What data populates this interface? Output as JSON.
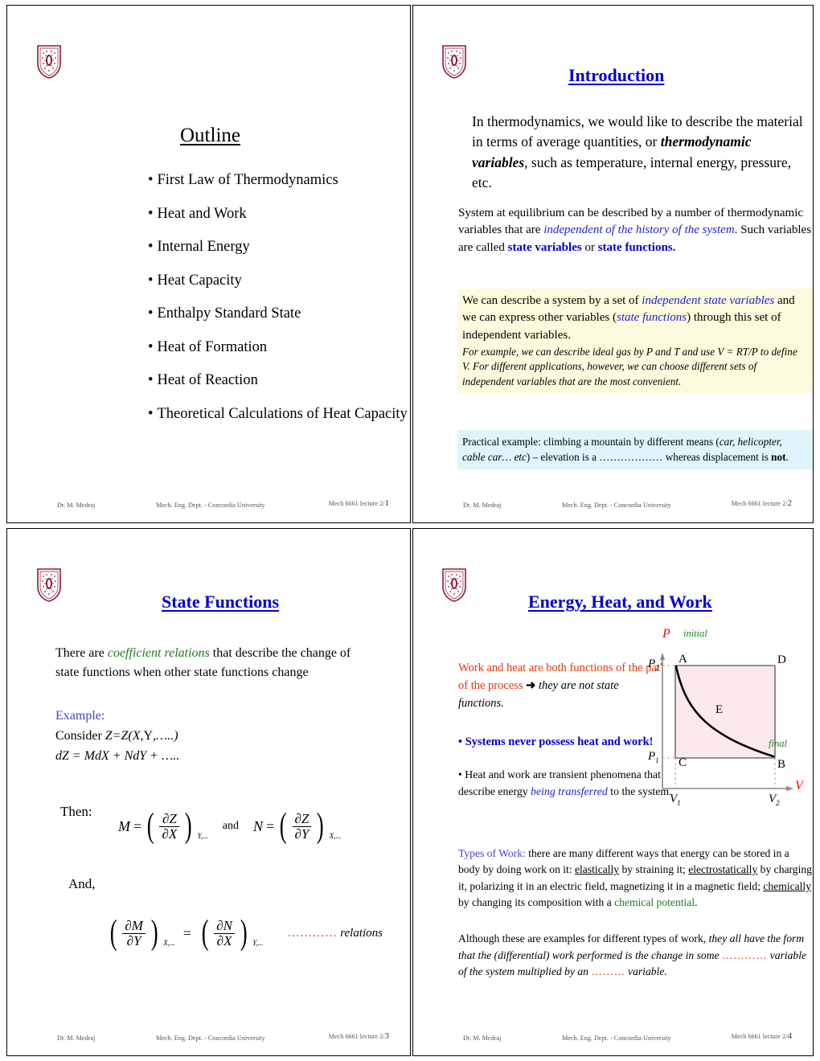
{
  "meta": {
    "author": "Dr. M. Medraj",
    "dept": "Mech. Eng. Dept. - Concordia University",
    "course_ref": "Mech 6661 lecture 2/",
    "logo_name": "Concordia University crest"
  },
  "slide1": {
    "title": "Outline",
    "bullet": "•",
    "items": [
      "First Law of Thermodynamics",
      "Heat and Work",
      "Internal Energy",
      "Heat Capacity",
      "Enthalpy Standard State",
      "Heat of Formation",
      "Heat of Reaction",
      "Theoretical Calculations of Heat Capacity"
    ],
    "page": "1"
  },
  "slide2": {
    "title": "Introduction",
    "p1_a": "In thermodynamics, we would like to describe the material in terms of average quantities, or ",
    "p1_em": "thermodynamic variables",
    "p1_b": ", such as temperature, internal energy, pressure, etc.",
    "p2_a": "System at equilibrium can be described by a number of thermodynamic variables that are ",
    "p2_em": "independent of the history of the system",
    "p2_b": ". Such variables are called ",
    "p2_s1": "state variables",
    "p2_c": " or ",
    "p2_s2": "state functions.",
    "p3_a": "We can describe a system by a set of ",
    "p3_em1": "independent state variables",
    "p3_b": " and we can express other variables (",
    "p3_em2": "state functions",
    "p3_c": ") through this set of independent variables.",
    "p3_it": "For example, we can describe ideal gas by P and T and use V = RT/P to define V. For different applications, however, we can choose different sets of independent variables that are the most convenient.",
    "p4_a": "Practical example: climbing a mountain by different means (",
    "p4_em": "car, helicopter, cable car… etc",
    "p4_b": ") – elevation is a ",
    "p4_dots": "………………",
    "p4_c": " whereas displacement is ",
    "p4_not": "not",
    "p4_d": ".",
    "page": "2"
  },
  "slide3": {
    "title": "State Functions",
    "p1_a": "There are ",
    "p1_em": "coefficient relations",
    "p1_b": " that describe the change of state functions when other state functions change",
    "example_label": "Example:",
    "consider_a": "Consider ",
    "consider_em": "Z=Z(X",
    "consider_mid": ",Y",
    "consider_end": ",…..)",
    "dz_line": "dZ = MdX + NdY + …..",
    "then_label": "Then:",
    "and_label": "And,",
    "eq1": {
      "lhs": "M",
      "eq": "=",
      "num": "∂Z",
      "den": "∂X",
      "sub": "Y,..."
    },
    "eq_and": "and",
    "eq2": {
      "lhs": "N",
      "eq": "=",
      "num": "∂Z",
      "den": "∂Y",
      "sub": "X,..."
    },
    "eq3": {
      "num1": "∂M",
      "den1": "∂Y",
      "sub1": "X,...",
      "eq": "=",
      "num2": "∂N",
      "den2": "∂X",
      "sub2": "Y,..."
    },
    "relations_dots": "…………",
    "relations_word": "relations",
    "page": "3"
  },
  "slide4": {
    "title": "Energy, Heat, and Work",
    "p1_a": "Work and heat are both functions of the path of the process ",
    "p1_arrow": "➜",
    "p1_em": " they are not state functions.",
    "b1": "• Systems never possess heat and work!",
    "b2_a": "• Heat and work are transient phenomena that describe energy ",
    "b2_em": "being transferred",
    "b2_b": " to the system.",
    "p2_label": "Types of Work:",
    "p2_a": " there are many different ways that energy can be stored in a body by doing work on it: ",
    "p2_u1": "elastically",
    "p2_b": " by straining it; ",
    "p2_u2": "electrostatically",
    "p2_c": " by charging it, polarizing it in an electric field, magnetizing it in a magnetic field; ",
    "p2_u3": "chemically",
    "p2_d": " by changing its composition with a ",
    "p2_green": "chemical potential",
    "p2_e": ".",
    "p3_a": "Although these are examples for different types of work, ",
    "p3_em1": "they all have the form that the (differential) work performed is the change in some ",
    "p3_dots1": "…………",
    "p3_em2": " variable of the system multiplied by an ",
    "p3_dots2": "………",
    "p3_em3": " variable.",
    "page": "4",
    "diagram": {
      "type": "pv-diagram",
      "axis_x": "V",
      "axis_y": "P",
      "label_initial": "initial",
      "label_final": "final",
      "points": [
        "A",
        "B",
        "C",
        "D",
        "E"
      ],
      "tick_y_top": "P",
      "tick_y_top_sub": "2",
      "tick_y_bottom": "P",
      "tick_y_bottom_sub": "1",
      "tick_x_left": "V",
      "tick_x_left_sub": "1",
      "tick_x_right": "V",
      "tick_x_right_sub": "2",
      "fill_color": "#FBE9EC",
      "axis_color": "#FF0000"
    }
  },
  "colors": {
    "title_blue": "#0000CC",
    "crest_maroon": "#8C1B2E",
    "accent_red": "#E8330B",
    "accent_green": "#1E7A1E",
    "highlight_yellow": "#FDFBDD",
    "highlight_cyan": "#DFF5FB"
  }
}
